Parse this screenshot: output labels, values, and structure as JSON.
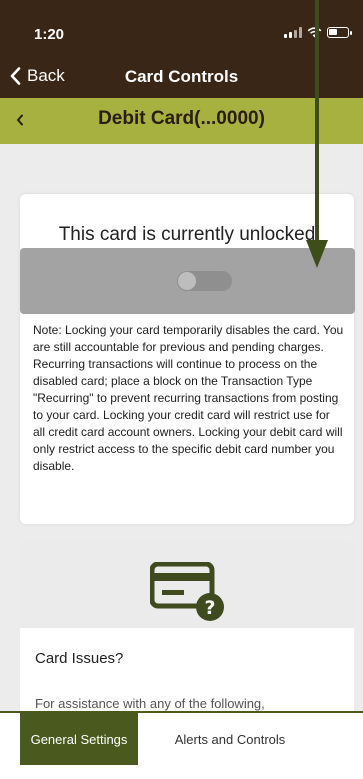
{
  "status_bar": {
    "time": "1:20"
  },
  "nav": {
    "back_label": "Back",
    "title": "Card Controls"
  },
  "card_selector": {
    "title": "Debit Card(...0000)",
    "prev_icon": "chevron-left-icon"
  },
  "lock": {
    "heading": "This card is currently unlocked",
    "toggle_on": false,
    "note": "Note: Locking your card temporarily disables the card. You are still accountable for previous and pending charges. Recurring transactions will continue to process on the disabled card; place a block on the Transaction Type \"Recurring\" to prevent recurring transactions from posting to your card. Locking your credit card will restrict use for all credit card account owners. Locking your debit card will only restrict access to the specific debit card number you disable."
  },
  "issues": {
    "icon": "card-question-icon",
    "title": "Card Issues?",
    "text": "For assistance with any of the following,"
  },
  "tabs": [
    {
      "label": "General Settings",
      "active": true
    },
    {
      "label": "Alerts and Controls",
      "active": false
    }
  ],
  "colors": {
    "header": "#3a2616",
    "accent": "#a6b13f",
    "tab_active": "#4a5a1e",
    "annotation_arrow": "#3d4e1a"
  }
}
